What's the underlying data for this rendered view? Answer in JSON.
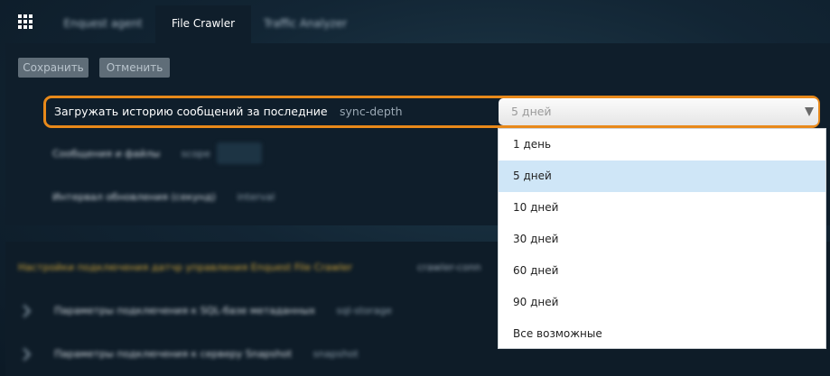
{
  "header": {
    "tabs": [
      {
        "label": "Enquest agent"
      },
      {
        "label": "File Crawler"
      },
      {
        "label": "Traffic Analyzer"
      }
    ]
  },
  "toolbar": {
    "save_label": "Сохранить",
    "cancel_label": "Отменить"
  },
  "settings": {
    "history": {
      "label": "Загружать историю сообщений за последние",
      "key": "sync-depth",
      "value": "5 дней",
      "options": [
        "1 день",
        "5 дней",
        "10 дней",
        "30 дней",
        "60 дней",
        "90 дней",
        "Все возможные"
      ],
      "selected_index": 1
    },
    "messages_row": {
      "label": "Сообщения и файлы",
      "key": "scope"
    },
    "interval_row": {
      "label": "Интервал обновления (секунд)",
      "key": "interval"
    }
  },
  "connection": {
    "section_title": "Настройки подключения датчр управления Enquest File Crawler",
    "section_key": "crawler-conn",
    "rows": [
      {
        "label": "Параметры подключения к SQL-базе метаданных",
        "key": "sql-storage"
      },
      {
        "label": "Параметры подключения к серверу Snapshot",
        "key": "snapshot"
      }
    ]
  },
  "colors": {
    "highlight": "#e8891a",
    "selected_option": "#cfe6f7",
    "panel": "#0f1e2b"
  },
  "icons": [
    "apps-grid-icon",
    "select-arrow-icon",
    "chevron-right-icon"
  ]
}
